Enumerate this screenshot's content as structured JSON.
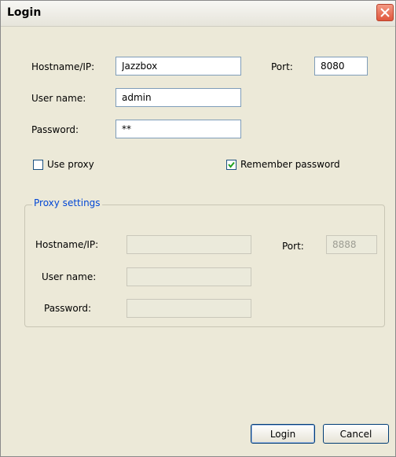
{
  "window": {
    "title": "Login"
  },
  "login": {
    "hostname_label": "Hostname/IP:",
    "hostname_value": "Jazzbox",
    "port_label": "Port:",
    "port_value": "8080",
    "username_label": "User name:",
    "username_value": "admin",
    "password_label": "Password:",
    "password_value": "**"
  },
  "options": {
    "use_proxy_label": "Use proxy",
    "use_proxy_checked": false,
    "remember_label": "Remember password",
    "remember_checked": true
  },
  "proxy": {
    "legend": "Proxy settings",
    "hostname_label": "Hostname/IP:",
    "hostname_value": "",
    "port_label": "Port:",
    "port_value": "8888",
    "username_label": "User name:",
    "username_value": "",
    "password_label": "Password:",
    "password_value": ""
  },
  "buttons": {
    "login": "Login",
    "cancel": "Cancel"
  }
}
